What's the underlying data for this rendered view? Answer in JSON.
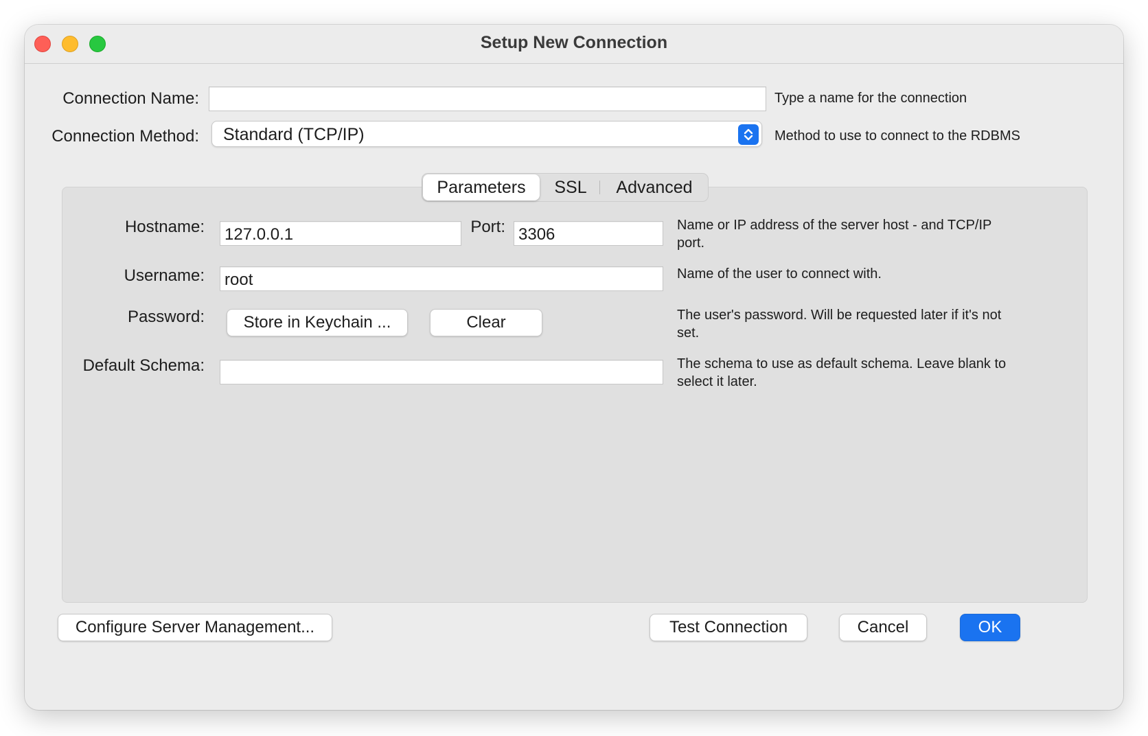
{
  "window": {
    "title": "Setup New Connection"
  },
  "connection": {
    "name_label": "Connection Name:",
    "name_value": "",
    "name_hint": "Type a name for the connection",
    "method_label": "Connection Method:",
    "method_value": "Standard (TCP/IP)",
    "method_hint": "Method to use to connect to the RDBMS"
  },
  "tabs": [
    {
      "label": "Parameters",
      "active": true
    },
    {
      "label": "SSL",
      "active": false
    },
    {
      "label": "Advanced",
      "active": false
    }
  ],
  "parameters": {
    "hostname_label": "Hostname:",
    "hostname_value": "127.0.0.1",
    "port_label": "Port:",
    "port_value": "3306",
    "hostname_hint": "Name or IP address of the server host - and TCP/IP port.",
    "username_label": "Username:",
    "username_value": "root",
    "username_hint": "Name of the user to connect with.",
    "password_label": "Password:",
    "store_keychain_label": "Store in Keychain ...",
    "clear_label": "Clear",
    "password_hint": "The user's password. Will be requested later if it's not set.",
    "schema_label": "Default Schema:",
    "schema_value": "",
    "schema_hint": "The schema to use as default schema. Leave blank to select it later."
  },
  "footer": {
    "configure_label": "Configure Server Management...",
    "test_label": "Test Connection",
    "cancel_label": "Cancel",
    "ok_label": "OK"
  },
  "colors": {
    "accent": "#1a73f0",
    "close": "#fe5f57",
    "minimize": "#febc2e",
    "zoom": "#28c840"
  },
  "icons": {
    "select_stepper": "chevron-up-down-icon"
  }
}
